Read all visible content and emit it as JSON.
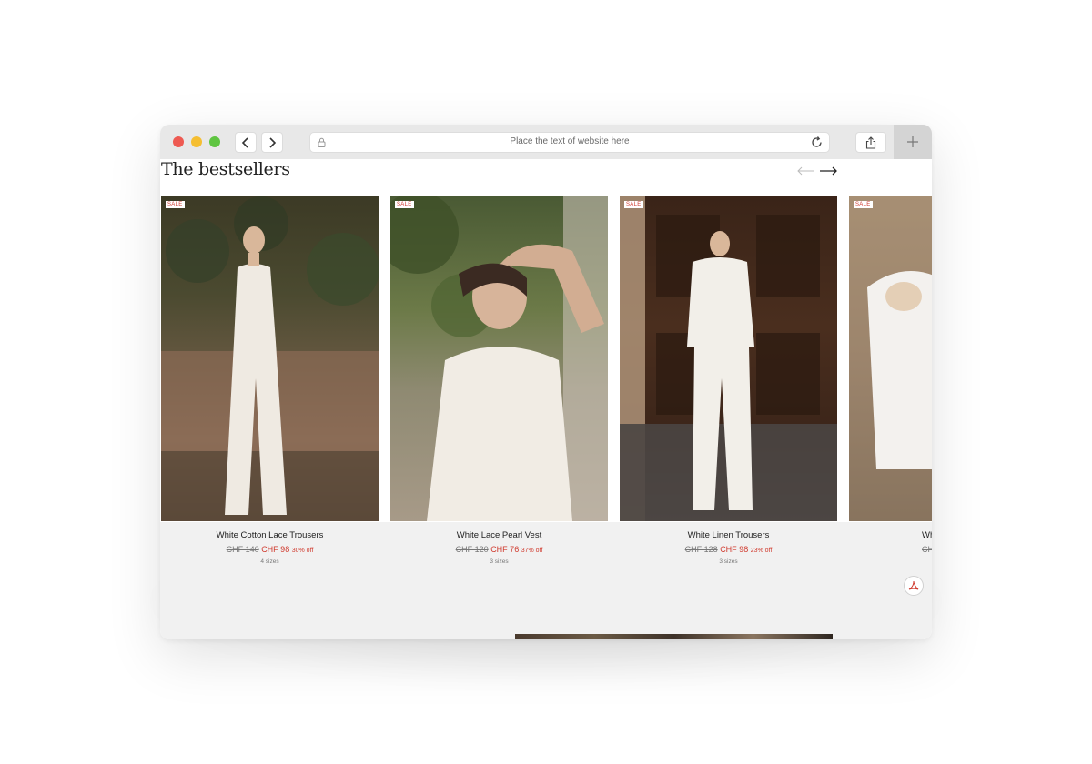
{
  "browser": {
    "address_placeholder": "Place the text of website here"
  },
  "page": {
    "section_title": "The bestsellers",
    "sale_label": "SALE",
    "products": [
      {
        "name": "White Cotton Lace Trousers",
        "old_price": "CHF 140",
        "new_price": "CHF 98",
        "discount": "30% off",
        "sizes": "4 sizes"
      },
      {
        "name": "White Lace Pearl Vest",
        "old_price": "CHF 120",
        "new_price": "CHF 76",
        "discount": "37% off",
        "sizes": "3 sizes"
      },
      {
        "name": "White Linen Trousers",
        "old_price": "CHF 128",
        "new_price": "CHF 98",
        "discount": "23% off",
        "sizes": "3 sizes"
      },
      {
        "name": "Wh",
        "old_price": "CHF",
        "new_price": "",
        "discount": "",
        "sizes": ""
      }
    ]
  },
  "colors": {
    "sale_red": "#d03a2e",
    "toolbar_bg": "#e8e8e8",
    "traffic_red": "#ee5a52",
    "traffic_yellow": "#f5be31",
    "traffic_green": "#5fc541"
  },
  "icons": [
    "back-icon",
    "forward-icon",
    "lock-icon",
    "reload-icon",
    "share-icon",
    "plus-icon",
    "arrow-left-icon",
    "arrow-right-icon",
    "pdf-icon"
  ]
}
